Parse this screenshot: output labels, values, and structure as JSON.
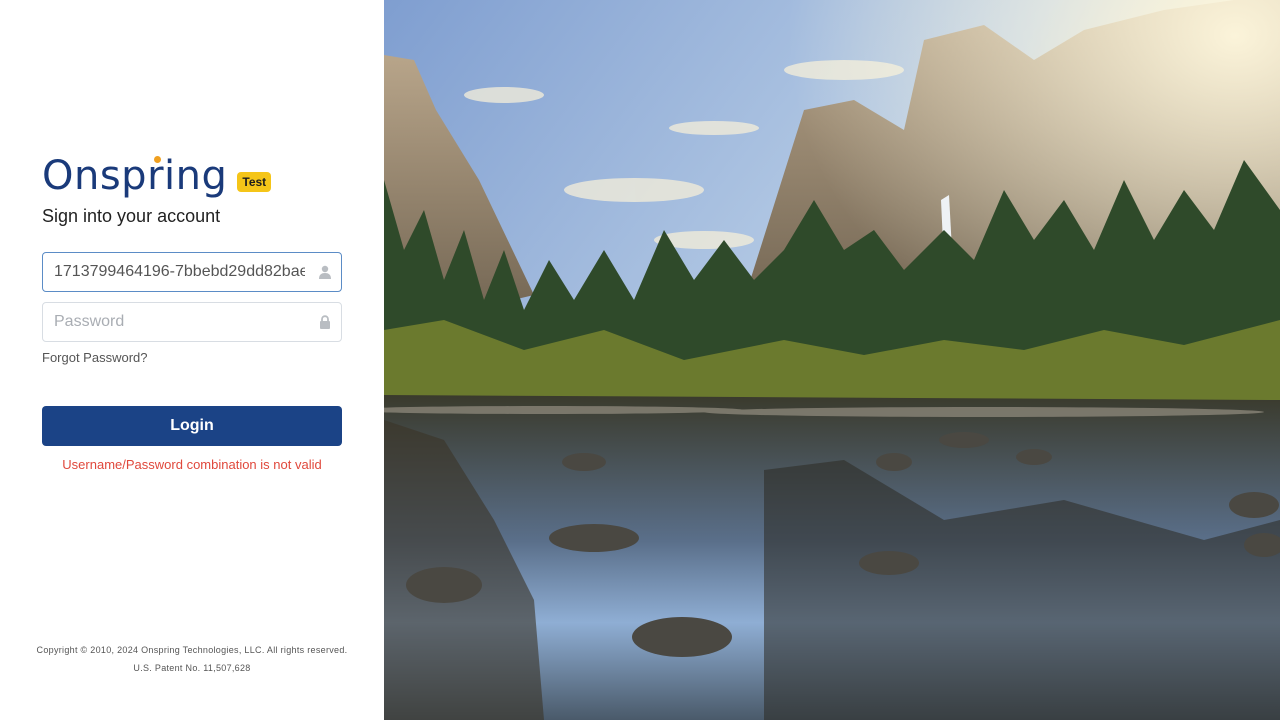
{
  "brand": {
    "logo_text": "Onspring",
    "env_badge": "Test"
  },
  "login": {
    "heading": "Sign into your account",
    "username": {
      "value": "1713799464196-7bbebd29dd82bae",
      "icon": "user-icon"
    },
    "password": {
      "placeholder": "Password",
      "icon": "lock-icon"
    },
    "forgot_label": "Forgot Password?",
    "submit_label": "Login",
    "error_message": "Username/Password combination is not valid"
  },
  "footer": {
    "copyright": "Copyright © 2010, 2024 Onspring Technologies, LLC. All rights reserved.",
    "patent": "U.S. Patent No. 11,507,628"
  },
  "colors": {
    "brand_navy": "#1b4386",
    "logo_accent": "#f0a020",
    "badge_yellow": "#f5c518",
    "error_red": "#e0483c"
  }
}
